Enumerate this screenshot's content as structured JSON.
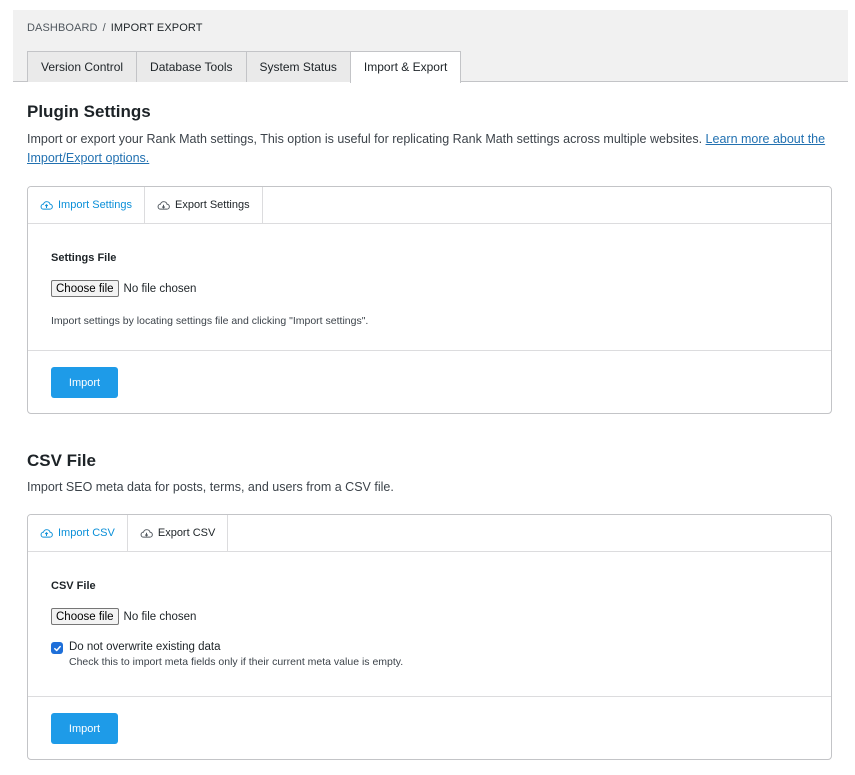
{
  "breadcrumb": {
    "root": "DASHBOARD",
    "separator": "/",
    "current": "IMPORT EXPORT"
  },
  "nav_tabs": [
    {
      "label": "Version Control"
    },
    {
      "label": "Database Tools"
    },
    {
      "label": "System Status"
    },
    {
      "label": "Import & Export",
      "active": true
    }
  ],
  "plugin_settings": {
    "title": "Plugin Settings",
    "description": "Import or export your Rank Math settings, This option is useful for replicating Rank Math settings across multiple websites. ",
    "link_text": "Learn more about the Import/Export options.",
    "tabs": [
      {
        "label": "Import Settings",
        "icon": "cloud-upload-icon",
        "active": true
      },
      {
        "label": "Export Settings",
        "icon": "cloud-download-icon"
      }
    ],
    "field_label": "Settings File",
    "choose_file_label": "Choose file",
    "no_file_text": "No file chosen",
    "help_text": "Import settings by locating settings file and clicking \"Import settings\".",
    "import_button": "Import"
  },
  "csv_file": {
    "title": "CSV File",
    "description": "Import SEO meta data for posts, terms, and users from a CSV file.",
    "tabs": [
      {
        "label": "Import CSV",
        "icon": "cloud-upload-icon",
        "active": true
      },
      {
        "label": "Export CSV",
        "icon": "cloud-download-icon"
      }
    ],
    "field_label": "CSV File",
    "choose_file_label": "Choose file",
    "no_file_text": "No file chosen",
    "checkbox_label": "Do not overwrite existing data",
    "checkbox_checked": true,
    "checkbox_help": "Check this to import meta fields only if their current meta value is empty.",
    "import_button": "Import"
  },
  "colors": {
    "accent": "#1e9be8",
    "active_tab_text": "#0a8fd8",
    "link": "#2271b1",
    "checkbox": "#1e6fd9"
  }
}
